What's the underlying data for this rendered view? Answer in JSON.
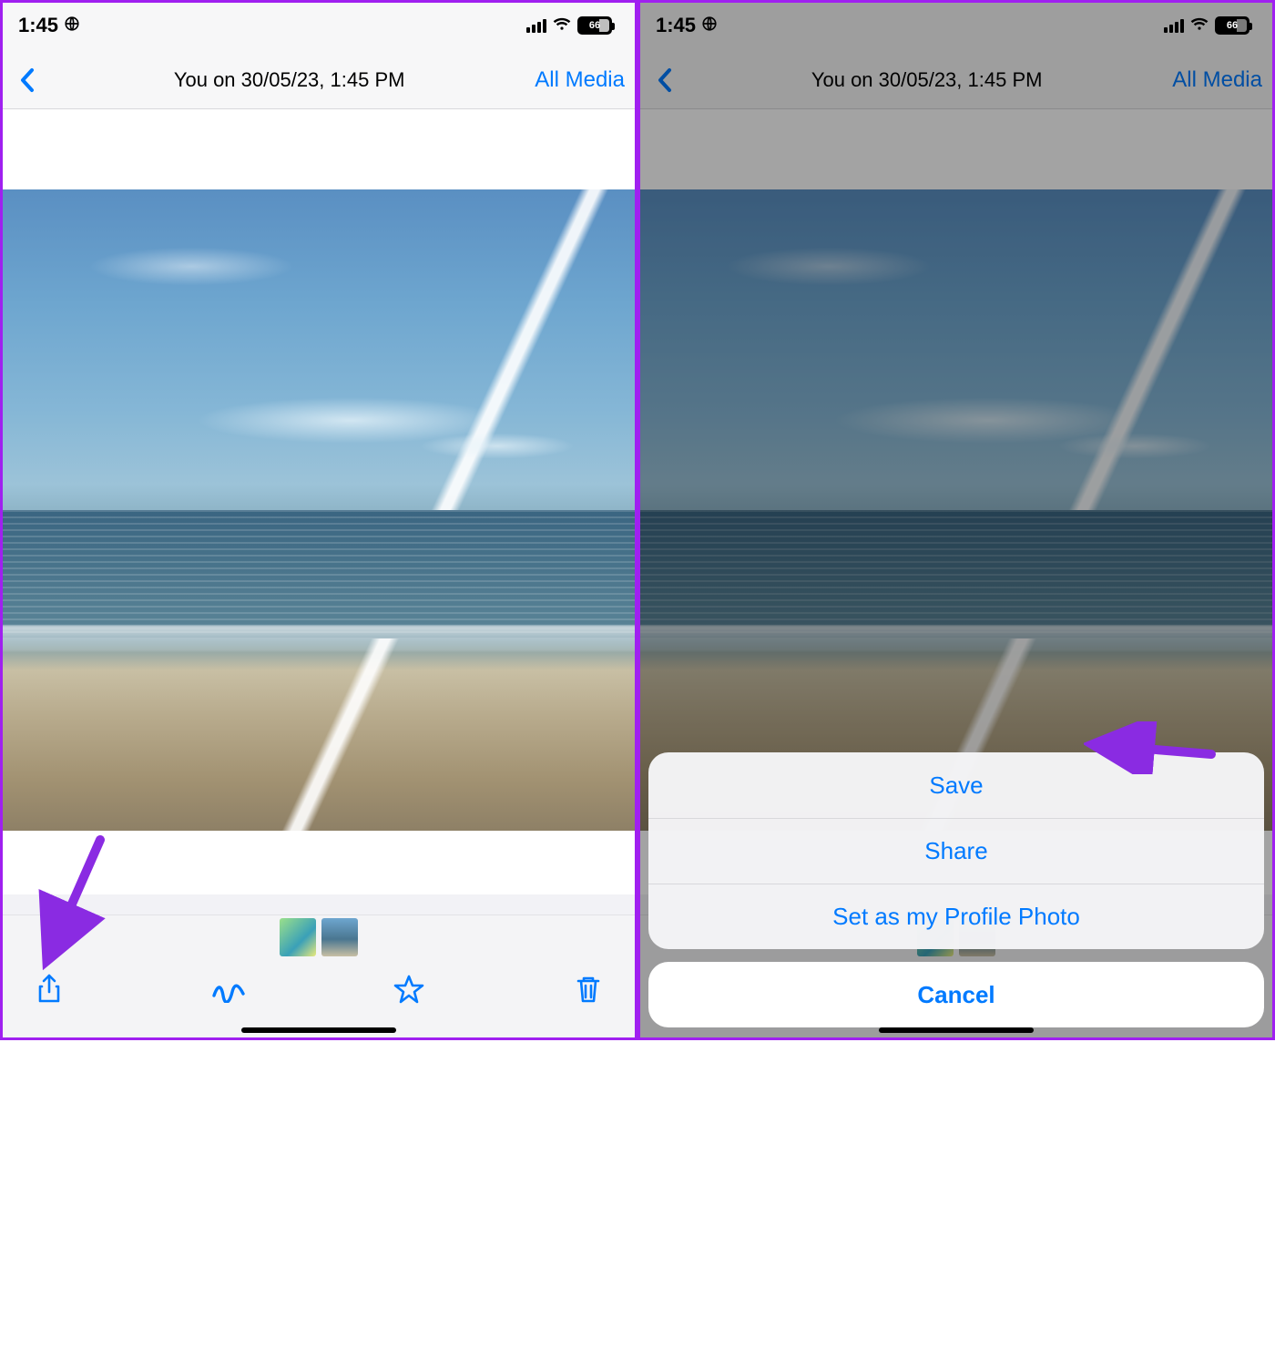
{
  "status": {
    "time": "1:45",
    "battery_pct": "66"
  },
  "nav": {
    "title": "You on 30/05/23, 1:45 PM",
    "right_link": "All Media"
  },
  "toolbar": {
    "share": "Share",
    "draw": "Draw",
    "star": "Star",
    "trash": "Delete"
  },
  "sheet": {
    "save": "Save",
    "share": "Share",
    "set_profile": "Set as my Profile Photo",
    "cancel": "Cancel"
  }
}
